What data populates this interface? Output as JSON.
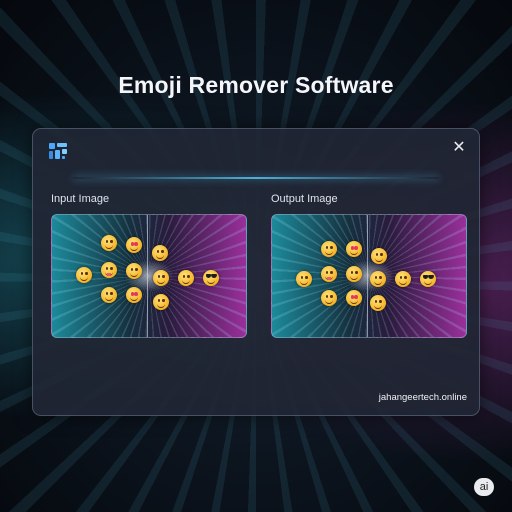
{
  "page": {
    "headline": "Emoji Remover Software",
    "corner_badge": "ai"
  },
  "window": {
    "logo_icon": "app-logo-icon",
    "close_icon": "close-icon",
    "close_label": "✕",
    "accent_color": "#5ad2ff",
    "watermark": "jahangeertech.online"
  },
  "panels": {
    "input": {
      "label": "Input Image"
    },
    "output": {
      "label": "Output Image"
    }
  }
}
